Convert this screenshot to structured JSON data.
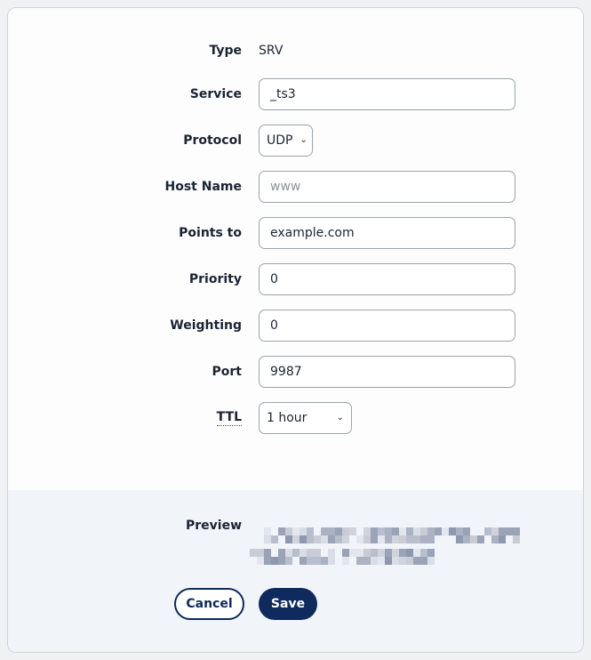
{
  "form": {
    "type": {
      "label": "Type",
      "value": "SRV"
    },
    "service": {
      "label": "Service",
      "value": "_ts3"
    },
    "protocol": {
      "label": "Protocol",
      "value": "UDP"
    },
    "host_name": {
      "label": "Host Name",
      "placeholder": "www",
      "value": ""
    },
    "points_to": {
      "label": "Points to",
      "value": "example.com"
    },
    "priority": {
      "label": "Priority",
      "value": "0"
    },
    "weighting": {
      "label": "Weighting",
      "value": "0"
    },
    "port": {
      "label": "Port",
      "value": "9987"
    },
    "ttl": {
      "label": "TTL",
      "value": "1 hour"
    }
  },
  "preview": {
    "label": "Preview"
  },
  "actions": {
    "cancel": "Cancel",
    "save": "Save"
  },
  "colors": {
    "primary": "#0f2a5c",
    "footer_bg": "#f1f4f8"
  }
}
